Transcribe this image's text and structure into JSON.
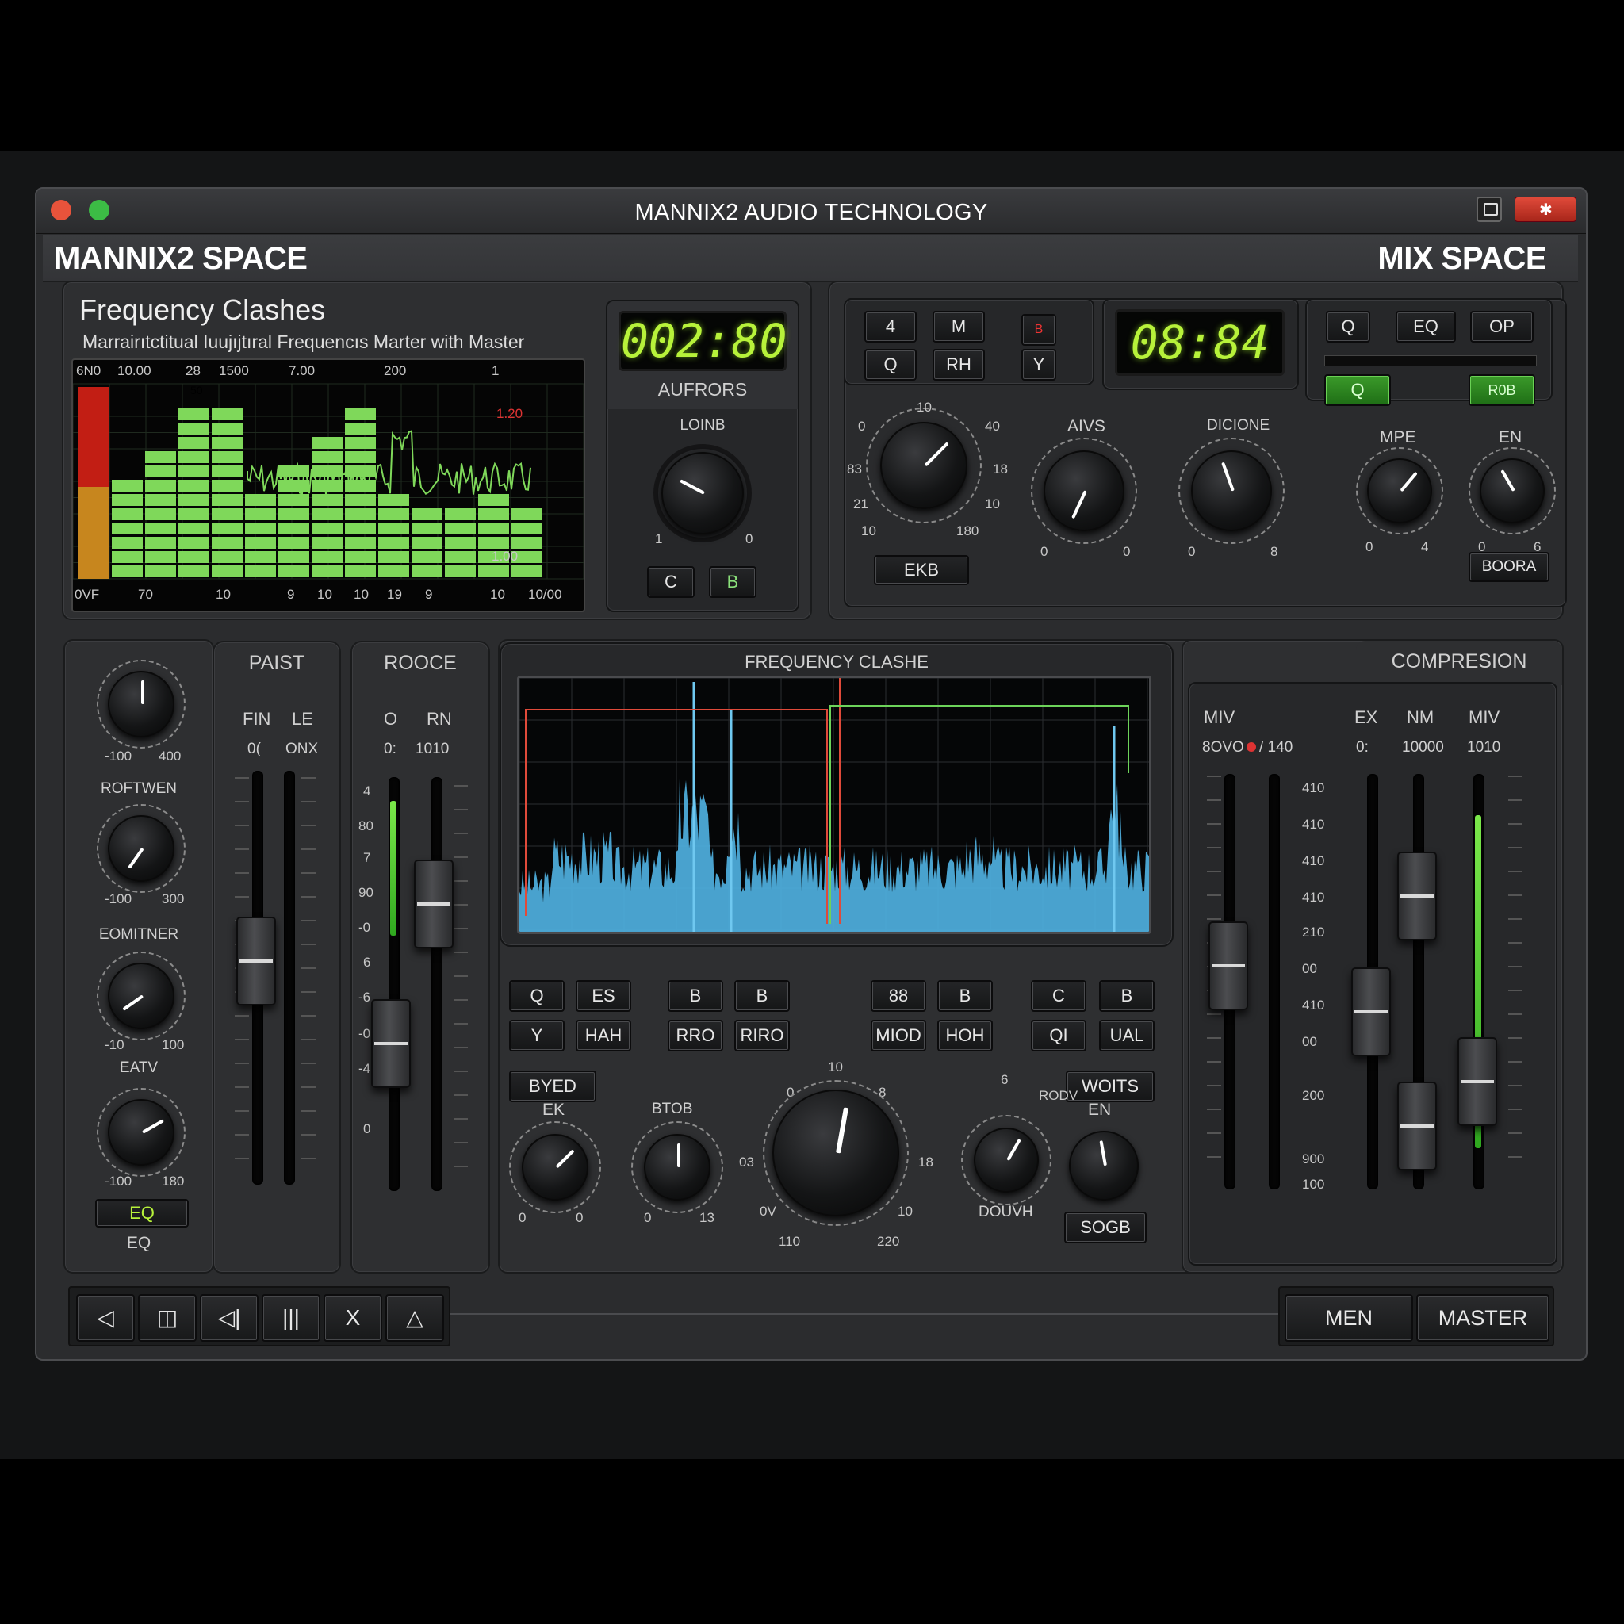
{
  "window": {
    "title": "MANNIX2 AUDIO TECHNOLOGY",
    "left_header": "MANNIX2 SPACE",
    "right_header": "MIX SPACE"
  },
  "freq_panel": {
    "title": "Frequency Clashes",
    "subtitle": "Marrairıtctitual Iuujıjtıral Frequencıs Marter with Master",
    "top_ticks": [
      "6N0",
      "10.00",
      "28",
      "1500",
      "7.00",
      "200",
      "1"
    ],
    "bottom_ticks": [
      "0VF",
      "70",
      "10",
      "9",
      "10",
      "10",
      "19",
      "9",
      "10",
      "10/00"
    ],
    "annot_red": "1.20",
    "annot_white": "1.00",
    "bar_tag": "50",
    "bars": [
      0.55,
      0.75,
      0.92,
      0.97,
      0.52,
      0.62,
      0.82,
      0.92,
      0.52,
      0.4,
      0.4,
      0.52,
      0.4
    ]
  },
  "lcd1": {
    "time": "002:80",
    "label": "AUFRORS"
  },
  "mini_knob": {
    "label": "LOINB",
    "left": "1",
    "right": "0",
    "btn_c": "C",
    "btn_b": "B"
  },
  "transport": {
    "b1": "4",
    "b2": "M",
    "b3": "Q",
    "b4": "RH",
    "b5": "Y",
    "red_label": "B"
  },
  "lcd2": {
    "time": "08:84"
  },
  "top_right_buttons": {
    "q": "Q",
    "eq": "EQ",
    "op": "OP",
    "green_q": "Q",
    "green_2": "R0B"
  },
  "top_knobs": [
    {
      "label": "10",
      "ticks": [
        "0",
        "40",
        "83",
        "18",
        "21",
        "10",
        "10",
        "180"
      ],
      "btn": "EKB"
    },
    {
      "label": "AIVS",
      "min": "0",
      "max": "0"
    },
    {
      "label": "DICIONE",
      "min": "0",
      "max": "8"
    },
    {
      "label": "MPE",
      "min": "0",
      "max": "4"
    },
    {
      "label": "EN",
      "min": "0",
      "max": "6",
      "btn": "BOORA"
    }
  ],
  "left_strip": {
    "k1": {
      "min": "-100",
      "max": "400"
    },
    "k2": {
      "label": "ROFTWEN",
      "min": "-100",
      "max": "300"
    },
    "k3": {
      "label": "EOMITNER",
      "min": "-10",
      "max": "100"
    },
    "k4": {
      "label": "EATV",
      "min": "-100",
      "max": "180"
    },
    "eq_btn": "EQ",
    "eq_label": "EQ"
  },
  "paist": {
    "title": "PAIST",
    "h1": "FIN",
    "h2": "LE",
    "v1": "0(",
    "v2": "ONX"
  },
  "rooce": {
    "title": "ROOCE",
    "h1": "O",
    "h2": "RN",
    "v1": "0:",
    "v2": "1010",
    "scale": [
      "4",
      "80",
      "7",
      "90",
      "-0",
      "6",
      "-6",
      "-0",
      "-4",
      "0"
    ]
  },
  "freq_clash": {
    "title": "FREQUENCY CLASHE"
  },
  "center_buttons": {
    "r1": [
      "Q",
      "ES",
      "B",
      "B",
      "88",
      "B",
      "C",
      "B"
    ],
    "r2": [
      "Y",
      "HAH",
      "RRO",
      "RIRO",
      "MIOD",
      "HOH",
      "QI",
      "UAL"
    ],
    "byed": "BYED",
    "woits": "WOITS"
  },
  "center_knobs": {
    "ek": {
      "label": "EK",
      "min": "0",
      "max": "0"
    },
    "btob": {
      "label": "BTOB",
      "min": "0",
      "max": "13"
    },
    "big": {
      "top": "10",
      "l1": "0",
      "r1": "8",
      "lside": "03",
      "rside": "18",
      "l2": "0V",
      "r2": "10",
      "bl": "110",
      "br": "220"
    },
    "douvh": {
      "label": "DOUVH",
      "top": "6",
      "side": "RODV"
    },
    "en": {
      "label": "EN",
      "btn": "SOGB"
    }
  },
  "compression": {
    "title": "COMPRESION",
    "h1": "MIV",
    "h2": "EX",
    "h3": "NM",
    "h4": "MIV",
    "v1": "8OVO",
    "v1b": "/ 140",
    "v2": "0:",
    "v3": "10000",
    "v4": "1010",
    "scale": [
      "410",
      "410",
      "410",
      "410",
      "210",
      "00",
      "410",
      "00",
      "200",
      "900",
      "100"
    ]
  },
  "bottom": {
    "icons": [
      "play-icon",
      "frame-icon",
      "speaker-icon",
      "bars-icon",
      "close-icon",
      "triangle-icon"
    ],
    "x_label": "X",
    "men": "MEN",
    "master": "MASTER"
  }
}
